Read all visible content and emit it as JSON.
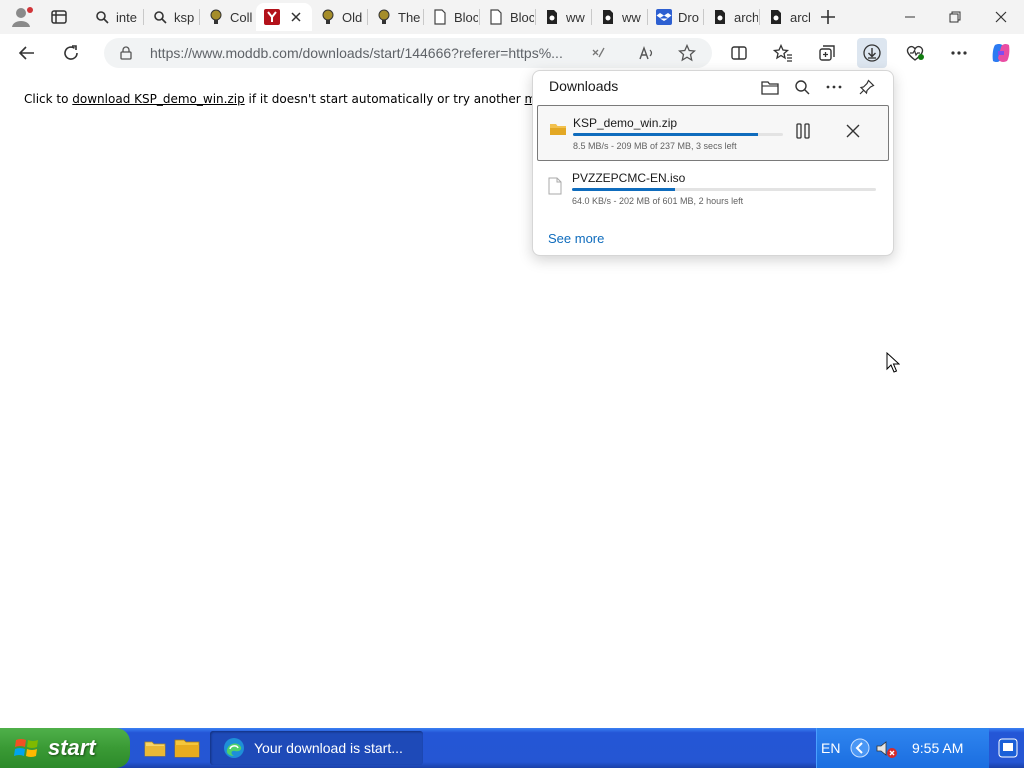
{
  "browser": {
    "tabs": [
      {
        "label": "inte",
        "icon": "search-icon"
      },
      {
        "label": "ksp",
        "icon": "search-icon"
      },
      {
        "label": "Coll",
        "icon": "bulb-icon"
      },
      {
        "label": "",
        "icon": "y-logo-icon",
        "active": true
      },
      {
        "label": "Old",
        "icon": "bulb-icon"
      },
      {
        "label": "The",
        "icon": "bulb-icon"
      },
      {
        "label": "Bloc",
        "icon": "page-icon"
      },
      {
        "label": "Bloc",
        "icon": "page-icon"
      },
      {
        "label": "ww",
        "icon": "archive-icon"
      },
      {
        "label": "ww",
        "icon": "archive-icon"
      },
      {
        "label": "Dro",
        "icon": "dropbox-icon"
      },
      {
        "label": "arch",
        "icon": "archive-icon"
      },
      {
        "label": "arch",
        "icon": "archive-icon"
      }
    ],
    "url": "https://www.moddb.com/downloads/start/144666?referer=https%..."
  },
  "page": {
    "message_prefix": "Click to ",
    "download_link": "download KSP_demo_win.zip",
    "message_middle": " if it doesn't start automatically or try another ",
    "mirror_link": "mirror",
    "message_suffix": "."
  },
  "downloads": {
    "title": "Downloads",
    "items": [
      {
        "name": "KSP_demo_win.zip",
        "status": "8.5 MB/s - 209 MB of 237 MB, 3 secs left",
        "progress": 0.88
      },
      {
        "name": "PVZZEPCMC-EN.iso",
        "status": "64.0 KB/s - 202 MB of 601 MB, 2 hours left",
        "progress": 0.34
      }
    ],
    "see_more": "See more"
  },
  "taskbar": {
    "start_label": "start",
    "task_label": "Your download is start...",
    "language": "EN",
    "clock": "9:55 AM"
  },
  "colors": {
    "accent": "#0f6cbd",
    "taskbar_blue": "#2556d3",
    "start_green": "#3a9a35"
  }
}
